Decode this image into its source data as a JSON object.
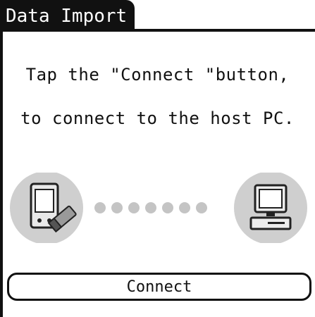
{
  "window": {
    "title": "Data Import"
  },
  "message": {
    "line1": "Tap the \"Connect \"button,",
    "line2": "to connect to the host PC."
  },
  "illustration": {
    "left_device_icon": "handheld-pda-icon",
    "right_device_icon": "desktop-pc-icon",
    "dot_count": 7,
    "circle_color": "#cfcfcf",
    "dot_color": "#c4c4c4"
  },
  "actions": {
    "connect_label": "Connect"
  }
}
